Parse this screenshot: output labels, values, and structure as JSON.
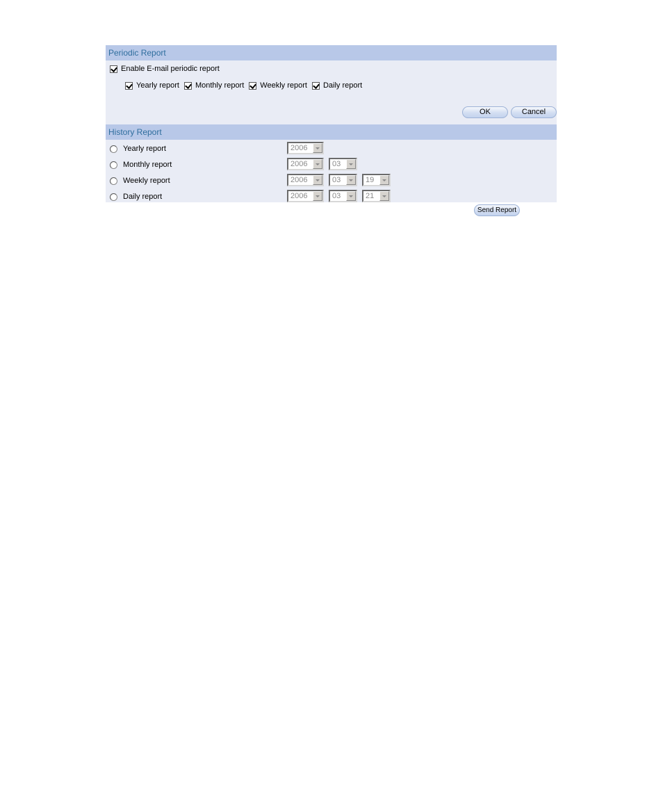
{
  "periodic": {
    "title": "Periodic Report",
    "enable_label": "Enable E-mail periodic report",
    "enable_checked": true,
    "options": [
      {
        "label": "Yearly report",
        "checked": true
      },
      {
        "label": "Monthly report",
        "checked": true
      },
      {
        "label": "Weekly report",
        "checked": true
      },
      {
        "label": "Daily report",
        "checked": true
      }
    ],
    "ok_label": "OK",
    "cancel_label": "Cancel"
  },
  "history": {
    "title": "History Report",
    "rows": [
      {
        "label": "Yearly report",
        "year": "2006"
      },
      {
        "label": "Monthly report",
        "year": "2006",
        "month": "03"
      },
      {
        "label": "Weekly report",
        "year": "2006",
        "month": "03",
        "day": "19"
      },
      {
        "label": "Daily report",
        "year": "2006",
        "month": "03",
        "day": "21"
      }
    ],
    "send_label": "Send Report"
  }
}
